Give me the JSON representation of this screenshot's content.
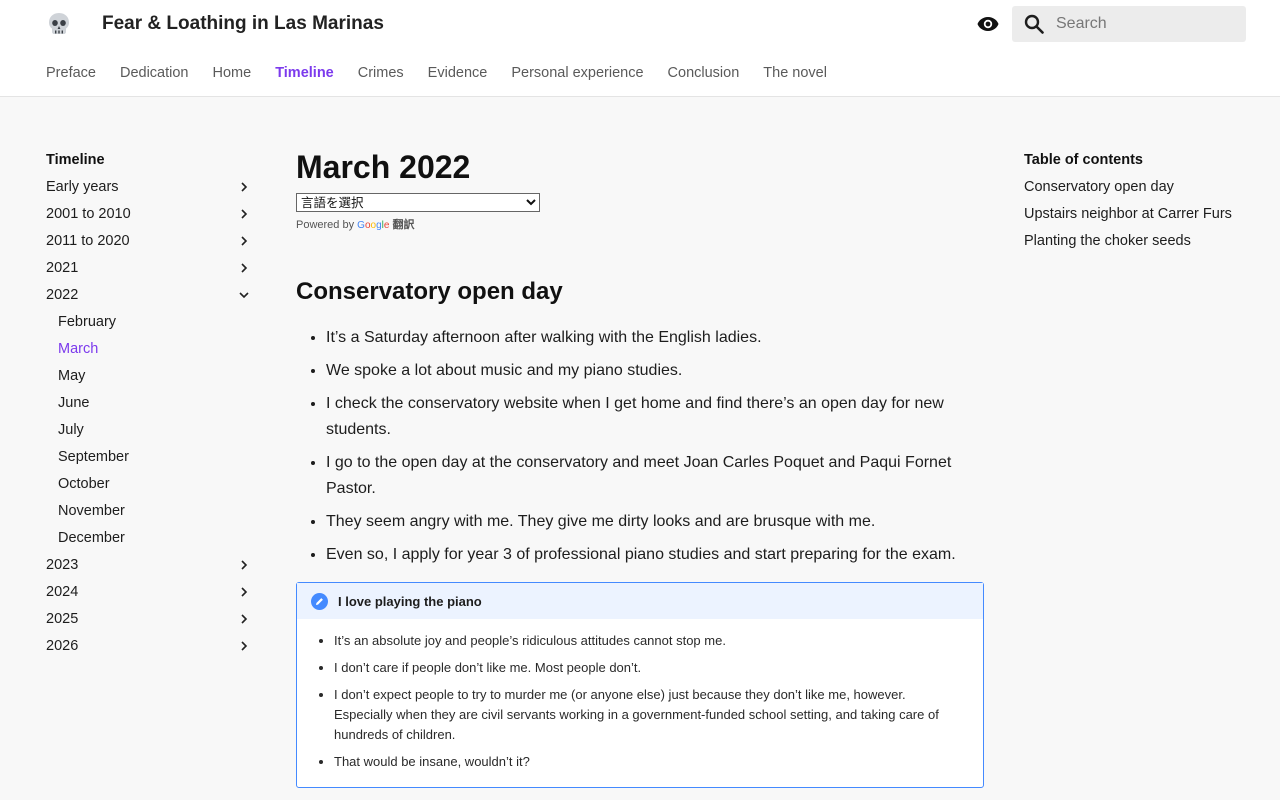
{
  "header": {
    "site_title": "Fear & Loathing in Las Marinas",
    "search_placeholder": "Search"
  },
  "nav": {
    "items": [
      "Preface",
      "Dedication",
      "Home",
      "Timeline",
      "Crimes",
      "Evidence",
      "Personal experience",
      "Conclusion",
      "The novel"
    ],
    "active": "Timeline"
  },
  "sidebar": {
    "heading": "Timeline",
    "items": [
      "Early years",
      "2001 to 2010",
      "2011 to 2020",
      "2021",
      "2022"
    ],
    "sub_items": [
      "February",
      "March",
      "May",
      "June",
      "July",
      "September",
      "October",
      "November",
      "December"
    ],
    "active_sub": "March",
    "items_after": [
      "2023",
      "2024",
      "2025",
      "2026"
    ]
  },
  "main": {
    "page_title": "March 2022",
    "lang_select": "言語を選択",
    "powered_by": "Powered by",
    "google": [
      "G",
      "o",
      "o",
      "g",
      "l",
      "e"
    ],
    "translate": "翻訳",
    "section_title": "Conservatory open day",
    "bullets": [
      "It’s a Saturday afternoon after walking with the English ladies.",
      "We spoke a lot about music and my piano studies.",
      "I check the conservatory website when I get home and find there’s an open day for new students.",
      "I go to the open day at the conservatory and meet Joan Carles Poquet and Paqui Fornet Pastor.",
      "They seem angry with me. They give me dirty looks and are brusque with me.",
      "Even so, I apply for year 3 of professional piano studies and start preparing for the exam."
    ],
    "note": {
      "title": "I love playing the piano",
      "items": [
        "It’s an absolute joy and people’s ridiculous attitudes cannot stop me.",
        "I don’t care if people don’t like me. Most people don’t.",
        "I don’t expect people to try to murder me (or anyone else) just because they don’t like me, however. Especially when they are civil servants working in a government-funded school setting, and taking care of hundreds of children.",
        "That would be insane, wouldn’t it?"
      ]
    }
  },
  "toc": {
    "heading": "Table of contents",
    "items": [
      "Conservatory open day",
      "Upstairs neighbor at Carrer Furs",
      "Planting the choker seeds"
    ]
  },
  "colors": {
    "accent": "#7c3aed",
    "note_border": "#448aff",
    "note_bg": "#ecf3ff"
  }
}
